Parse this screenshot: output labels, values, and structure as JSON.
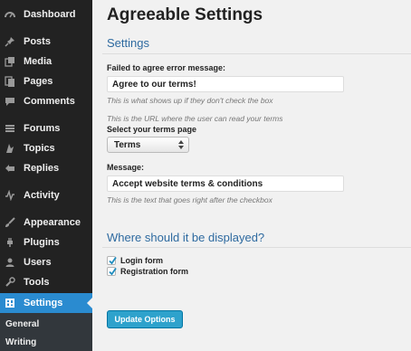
{
  "sidebar": {
    "items": [
      {
        "label": "Dashboard",
        "icon": "dashboard-icon"
      },
      {
        "label": "Posts",
        "icon": "pin-icon"
      },
      {
        "label": "Media",
        "icon": "media-icon"
      },
      {
        "label": "Pages",
        "icon": "pages-icon"
      },
      {
        "label": "Comments",
        "icon": "comment-icon"
      },
      {
        "label": "Forums",
        "icon": "forums-icon"
      },
      {
        "label": "Topics",
        "icon": "topics-icon"
      },
      {
        "label": "Replies",
        "icon": "replies-icon"
      },
      {
        "label": "Activity",
        "icon": "activity-icon"
      },
      {
        "label": "Appearance",
        "icon": "brush-icon"
      },
      {
        "label": "Plugins",
        "icon": "plug-icon"
      },
      {
        "label": "Users",
        "icon": "users-icon"
      },
      {
        "label": "Tools",
        "icon": "wrench-icon"
      },
      {
        "label": "Settings",
        "icon": "settings-icon",
        "active": true
      }
    ],
    "submenu": [
      {
        "label": "General"
      },
      {
        "label": "Writing"
      }
    ],
    "colors": {
      "background": "#222222",
      "active": "#2a8bd0"
    }
  },
  "main": {
    "title": "Agreeable Settings",
    "section_settings": "Settings",
    "fields": {
      "error_label": "Failed to agree error message:",
      "error_value": "Agree to our terms!",
      "error_help": "This is what shows up if they don't check the box",
      "url_help": "This is the URL where the user can read your terms",
      "terms_page_label": "Select your terms page",
      "terms_page_value": "Terms",
      "message_label": "Message:",
      "message_value": "Accept website terms & conditions",
      "message_help": "This is the text that goes right after the checkbox"
    },
    "section_where": "Where should it be displayed?",
    "checkboxes": [
      {
        "label": "Login form",
        "checked": true
      },
      {
        "label": "Registration form",
        "checked": true
      }
    ],
    "update_button": "Update Options",
    "colors": {
      "heading": "#2e6aa0",
      "button": "#2ea2cc"
    }
  }
}
